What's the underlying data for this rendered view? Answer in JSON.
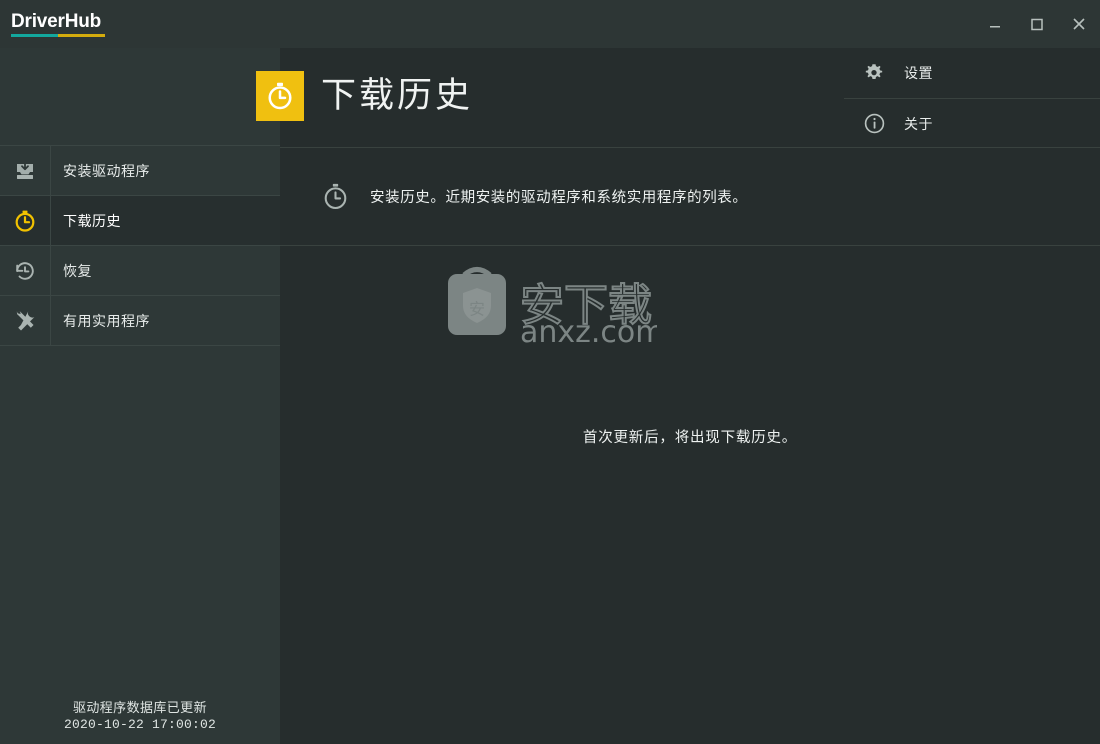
{
  "window": {
    "app_name": "DriverHub",
    "logo_color_left": "#13a89e",
    "logo_color_right": "#d4ac0d",
    "minimize_label": "_",
    "maximize_label": "□",
    "close_label": "✕"
  },
  "sidebar": {
    "items": [
      {
        "label": "安装驱动程序",
        "icon": "inbox-download-icon",
        "active": false
      },
      {
        "label": "下载历史",
        "icon": "clock-icon",
        "active": true
      },
      {
        "label": "恢复",
        "icon": "history-restore-icon",
        "active": false
      },
      {
        "label": "有用实用程序",
        "icon": "tools-icon",
        "active": false
      }
    ],
    "footer": {
      "line1": "驱动程序数据库已更新",
      "line2": "2020-10-22 17:00:02"
    },
    "active_accent": "#f2c200"
  },
  "header": {
    "title": "下载历史",
    "badge_icon": "stopwatch-icon",
    "badge_color": "#f0c010"
  },
  "topmenu": {
    "items": [
      {
        "label": "设置",
        "icon": "gear-icon"
      },
      {
        "label": "关于",
        "icon": "info-circle-icon"
      }
    ]
  },
  "info": {
    "icon": "stopwatch-icon",
    "text": "安装历史。近期安装的驱动程序和系统实用程序的列表。"
  },
  "empty_state": {
    "message": "首次更新后，将出现下载历史。",
    "watermark": {
      "badge_char": "安",
      "title": "安下载",
      "domain": "anxz.com",
      "color": "#7c8584"
    }
  }
}
